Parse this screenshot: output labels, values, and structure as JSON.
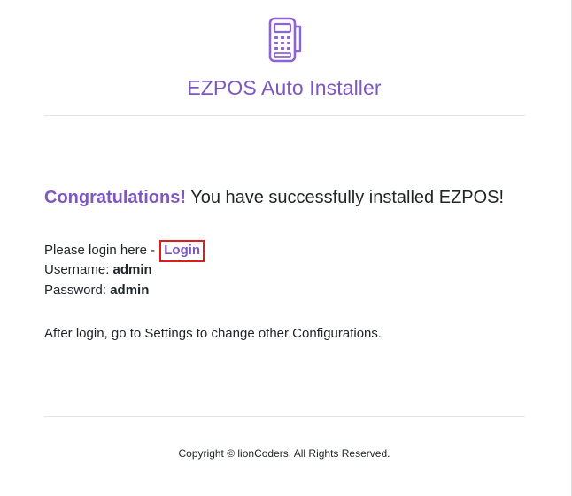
{
  "header": {
    "logo_icon": "card-terminal-icon",
    "title": "EZPOS Auto Installer"
  },
  "main": {
    "congrats_strong": "Congratulations!",
    "congrats_text": " You have successfully installed EZPOS!",
    "login_prompt": "Please login here - ",
    "login_link": "Login",
    "username_label": "Username: ",
    "username_value": "admin",
    "password_label": "Password: ",
    "password_value": "admin",
    "after_login": "After login, go to Settings to change other Configurations."
  },
  "footer": {
    "copyright": "Copyright © lionCoders. All Rights Reserved."
  },
  "colors": {
    "accent": "#7e57c2",
    "highlight_border": "#e01b1b"
  }
}
